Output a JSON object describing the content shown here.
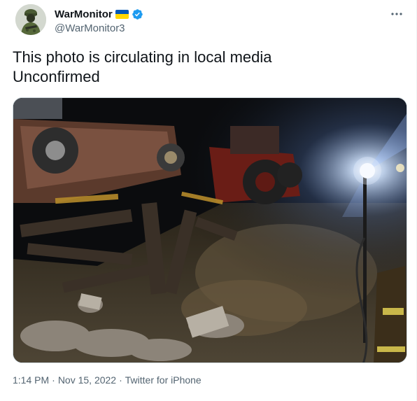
{
  "author": {
    "display_name": "WarMonitor",
    "handle": "@WarMonitor3",
    "avatar_icon": "soldier-avatar",
    "flag_icon": "ukraine-flag-icon",
    "verified_icon": "verified-badge-icon",
    "flag_colors": [
      "#0057b7",
      "#ffd700"
    ],
    "verified_color": "#1d9bf0"
  },
  "more_icon": "more-options-icon",
  "tweet_text": {
    "line1": "This photo is circulating in local media",
    "line2": "Unconfirmed"
  },
  "media": {
    "kind": "photo",
    "icon": "night-debris-photo"
  },
  "meta": {
    "time": "1:14 PM",
    "separator1": "·",
    "date": "Nov 15, 2022",
    "separator2": "·",
    "source": "Twitter for iPhone"
  }
}
